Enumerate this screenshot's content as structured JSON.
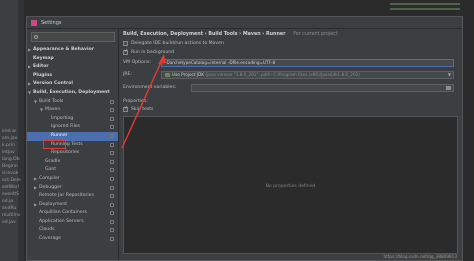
{
  "dialog": {
    "title": "Settings"
  },
  "sidebar": {
    "search_placeholder": "",
    "items": [
      {
        "label": "Appearance & Behavior",
        "indent": 0,
        "expander": "right",
        "bold": true
      },
      {
        "label": "Keymap",
        "indent": 0,
        "expander": "",
        "bold": true
      },
      {
        "label": "Editor",
        "indent": 0,
        "expander": "right",
        "bold": true
      },
      {
        "label": "Plugins",
        "indent": 0,
        "expander": "",
        "bold": true
      },
      {
        "label": "Version Control",
        "indent": 0,
        "expander": "right",
        "bold": true
      },
      {
        "label": "Build, Execution, Deployment",
        "indent": 0,
        "expander": "down",
        "bold": true
      },
      {
        "label": "Build Tools",
        "indent": 1,
        "expander": "down",
        "bold": false
      },
      {
        "label": "Maven",
        "indent": 2,
        "expander": "down",
        "bold": false
      },
      {
        "label": "Importing",
        "indent": 3,
        "expander": "",
        "bold": false
      },
      {
        "label": "Ignored Files",
        "indent": 3,
        "expander": "",
        "bold": false
      },
      {
        "label": "Runner",
        "indent": 3,
        "expander": "",
        "bold": false,
        "selected": true
      },
      {
        "label": "Running Tests",
        "indent": 3,
        "expander": "",
        "bold": false
      },
      {
        "label": "Repositories",
        "indent": 3,
        "expander": "",
        "bold": false
      },
      {
        "label": "Gradle",
        "indent": 2,
        "expander": "",
        "bold": false
      },
      {
        "label": "Gant",
        "indent": 2,
        "expander": "",
        "bold": false
      },
      {
        "label": "Compiler",
        "indent": 1,
        "expander": "right",
        "bold": false
      },
      {
        "label": "Debugger",
        "indent": 1,
        "expander": "right",
        "bold": false
      },
      {
        "label": "Remote Jar Repositories",
        "indent": 1,
        "expander": "",
        "bold": false
      },
      {
        "label": "Deployment",
        "indent": 1,
        "expander": "right",
        "bold": false
      },
      {
        "label": "Arquillian Containers",
        "indent": 1,
        "expander": "",
        "bold": false
      },
      {
        "label": "Application Servers",
        "indent": 1,
        "expander": "",
        "bold": false
      },
      {
        "label": "Clouds",
        "indent": 1,
        "expander": "",
        "bold": false
      },
      {
        "label": "Coverage",
        "indent": 1,
        "expander": "",
        "bold": false
      }
    ]
  },
  "breadcrumb": {
    "path": "Build, Execution, Deployment  ›  Build Tools  ›  Maven  ›  Runner",
    "project_note": "For current project"
  },
  "runner": {
    "delegate_label": "Delegate IDE build/run actions to Maven",
    "delegate_checked": false,
    "background_label": "Run in background",
    "background_checked": true,
    "vm_options_label": "VM Options:",
    "vm_options_value": "-DarchetypeCatalog=internal -Dfile.encoding=UTF-8",
    "jre_label": "JRE:",
    "jre_value_name": "Use Project JDK",
    "jre_value_detail": "(java version \"1.8.0_201\", path: C:/Program Files (x86)/Java/jdk1.8.0_201)",
    "env_label": "Environment variables:",
    "env_value": "",
    "properties_label": "Properties:",
    "skip_tests_label": "Skip tests",
    "skip_tests_checked": true,
    "no_properties_text": "No properties defined"
  },
  "watermark": "https://blog.csdn.net/qq_38809813",
  "background_ide": {
    "left_lines": [
      "ired w",
      "om.jav",
      "k.prin",
      "intJav",
      "lang.Ob",
      "Beginn",
      "d.invok",
      "ect.Dele",
      "setWorl",
      "evenItS",
      "od.ja",
      "andRu",
      "multiInv",
      "ed.jav"
    ]
  },
  "colors": {
    "selection": "#4b6eaf",
    "highlight_annotation": "#e53935",
    "panel": "#3c3f41"
  }
}
